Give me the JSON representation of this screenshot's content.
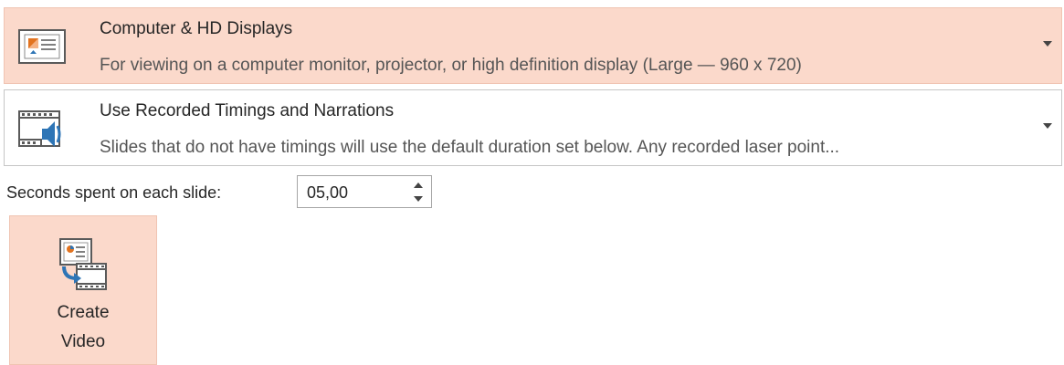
{
  "export_quality": {
    "title": "Computer & HD Displays",
    "description": "For viewing on a computer monitor, projector, or high definition display  (Large — 960 x 720)",
    "icon": "display-presentation-icon"
  },
  "timings": {
    "title": "Use Recorded Timings and Narrations",
    "description": "Slides that do not have timings will use the default duration set below. Any recorded laser point...",
    "icon": "filmstrip-speaker-icon"
  },
  "seconds": {
    "label": "Seconds spent on each slide:",
    "value": "05,00"
  },
  "create_video": {
    "line1": "Create",
    "line2": "Video",
    "icon": "create-video-icon"
  },
  "colors": {
    "selected_bg": "#fbd9cb",
    "selected_border": "#f0c4b2",
    "accent_blue": "#2e75b6",
    "accent_orange": "#e2731f"
  }
}
